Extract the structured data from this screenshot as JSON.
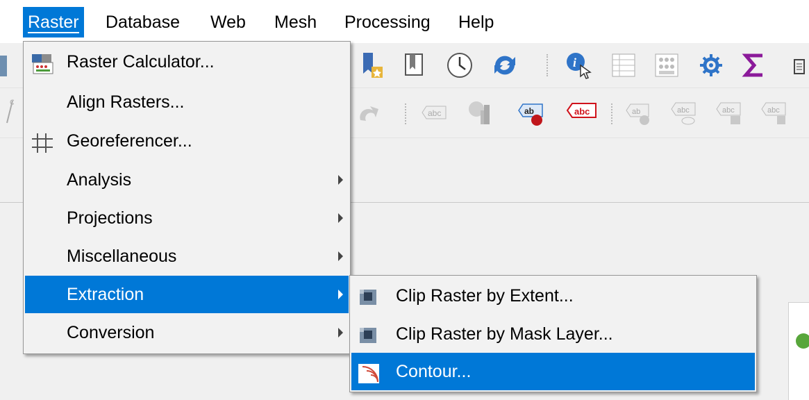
{
  "menubar": {
    "items": [
      {
        "label": "Raster",
        "active": true
      },
      {
        "label": "Database",
        "active": false
      },
      {
        "label": "Web",
        "active": false
      },
      {
        "label": "Mesh",
        "active": false
      },
      {
        "label": "Processing",
        "active": false
      },
      {
        "label": "Help",
        "active": false
      }
    ]
  },
  "raster_menu": {
    "items": [
      {
        "label": "Raster Calculator...",
        "icon": "raster-calculator-icon"
      },
      {
        "label": "Align Rasters..."
      },
      {
        "label": "Georeferencer...",
        "icon": "georeferencer-icon"
      },
      {
        "label": "Analysis",
        "submenu": true
      },
      {
        "label": "Projections",
        "submenu": true
      },
      {
        "label": "Miscellaneous",
        "submenu": true
      },
      {
        "label": "Extraction",
        "submenu": true,
        "highlighted": true
      },
      {
        "label": "Conversion",
        "submenu": true
      }
    ]
  },
  "extraction_submenu": {
    "items": [
      {
        "label": "Clip Raster by Extent...",
        "icon": "clip-raster-icon"
      },
      {
        "label": "Clip Raster by Mask Layer...",
        "icon": "clip-raster-icon"
      },
      {
        "label": "Contour...",
        "icon": "contour-icon",
        "highlighted": true
      }
    ]
  },
  "toolbar": {
    "icons": [
      "new-bookmark-icon",
      "show-bookmarks-icon",
      "temporal-controller-icon",
      "refresh-icon",
      "identify-features-icon",
      "open-attribute-table-icon",
      "open-field-calculator-icon",
      "processing-toolbox-icon",
      "statistical-summary-icon"
    ],
    "label_icons_text": "abc",
    "label_icon_ab": "ab"
  },
  "colors": {
    "accent": "#0078d7",
    "menu_bg": "#f2f2f2",
    "menubar_bg": "#ffffff"
  }
}
